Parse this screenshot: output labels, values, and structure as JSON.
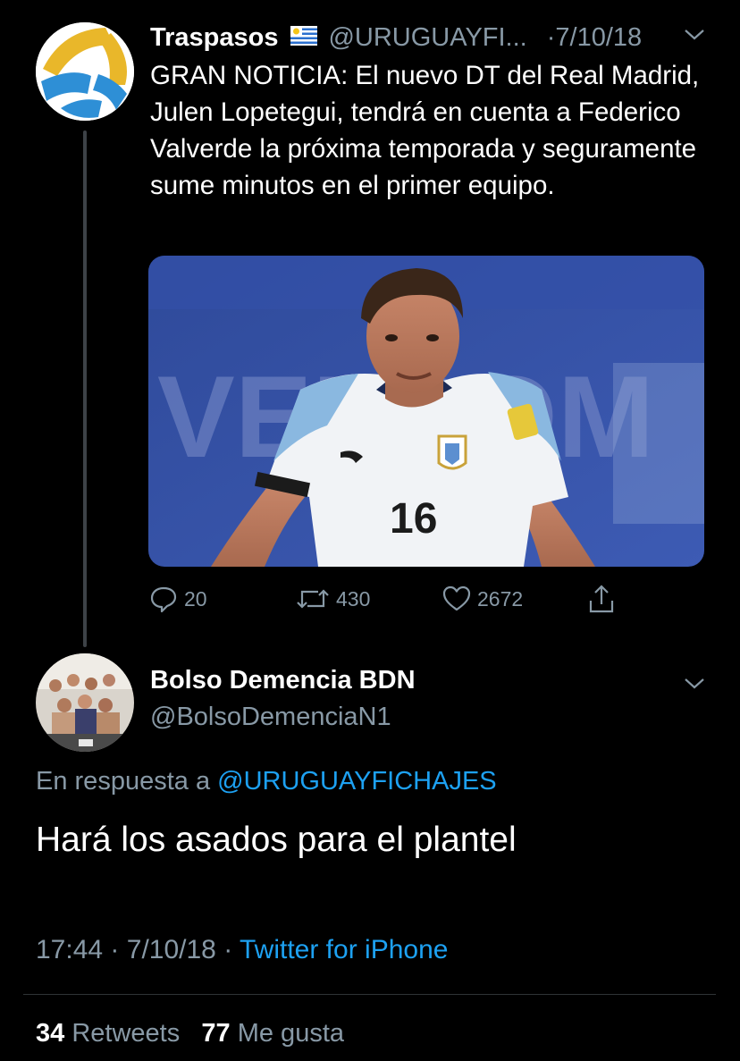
{
  "parent_tweet": {
    "display_name": "Traspasos",
    "flag_icon": "uruguay-flag",
    "handle": "@URUGUAYFI...",
    "separator": "·",
    "date": "7/10/18",
    "text": "GRAN NOTICIA: El nuevo DT del Real Madrid, Julen Lopetegui, tendrá en cuenta a Federico Valverde la próxima temporada y seguramente sume minutos en el primer equipo.",
    "media": {
      "jersey_number": "16",
      "banner_text": "VELCOM"
    },
    "actions": {
      "replies": "20",
      "retweets": "430",
      "likes": "2672"
    }
  },
  "reply_tweet": {
    "display_name": "Bolso Demencia BDN",
    "handle": "@BolsoDemenciaN1",
    "reply_prefix": "En respuesta a",
    "reply_mention": "@URUGUAYFICHAJES",
    "text": "Hará los asados para el plantel",
    "time": "17:44",
    "sep1": "·",
    "date": "7/10/18",
    "sep2": "·",
    "source": "Twitter for iPhone",
    "retweets_count": "34",
    "retweets_label": "Retweets",
    "likes_count": "77",
    "likes_label": "Me gusta"
  },
  "colors": {
    "background": "#000000",
    "text_primary": "#ffffff",
    "text_secondary": "#8899a6",
    "link": "#1da1f2"
  }
}
